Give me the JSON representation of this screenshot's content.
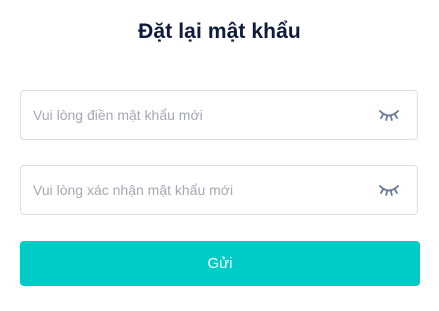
{
  "page_title": "Đặt lại mật khẩu",
  "new_password": {
    "placeholder": "Vui lòng điền mật khẩu mới",
    "value": "",
    "toggle_icon": "eye-closed-icon"
  },
  "confirm_password": {
    "placeholder": "Vui lòng xác nhận mật khẩu mới",
    "value": "",
    "toggle_icon": "eye-closed-icon"
  },
  "submit_label": "Gửi",
  "colors": {
    "accent": "#00ccc7",
    "title": "#0e1b3d",
    "placeholder": "#a3a8b3",
    "border": "#dcdfe6",
    "icon": "#6b7a99"
  }
}
